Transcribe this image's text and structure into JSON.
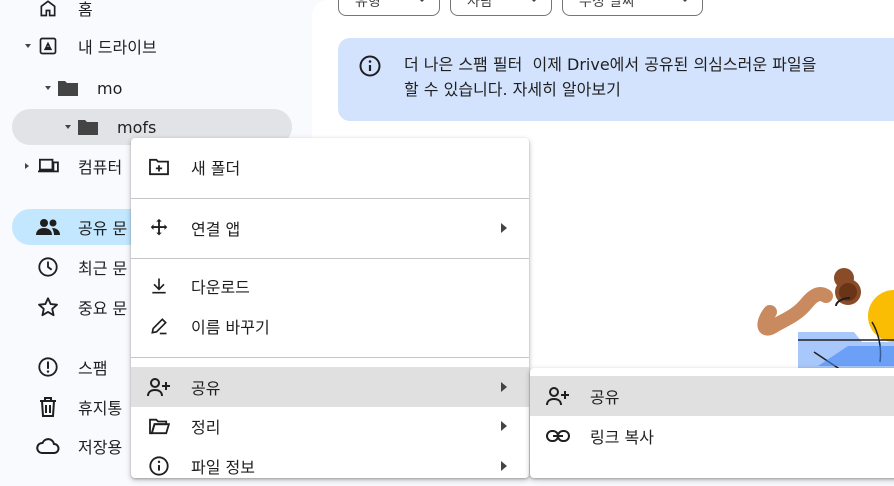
{
  "sidebar": {
    "home": "홈",
    "my_drive": "내 드라이브",
    "folder_mo": "mo",
    "folder_mofs": "mofs",
    "computers": "컴퓨터",
    "shared": "공유 문",
    "recent": "최근 문",
    "starred": "중요 문",
    "spam": "스팸",
    "trash": "휴지통",
    "storage": "저장용"
  },
  "filters": {
    "chip1": "유형",
    "chip2": "사람",
    "chip3": "수정 날짜"
  },
  "banner": {
    "title": "더 나은 스팸 필터",
    "line1": "이제 Drive에서 공유된 의심스러운 파일을",
    "line2": "할 수 있습니다. 자세히 알아보기"
  },
  "context_menu": {
    "new_folder": "새 폴더",
    "open_with": "연결 앱",
    "download": "다운로드",
    "rename": "이름 바꾸기",
    "share": "공유",
    "organize": "정리",
    "file_info": "파일 정보"
  },
  "submenu": {
    "share": "공유",
    "copy_link": "링크 복사"
  },
  "colors": {
    "accent_light": "#c2e7ff",
    "banner_bg": "#d3e3fd",
    "menu_highlight": "#e0e0e0"
  }
}
